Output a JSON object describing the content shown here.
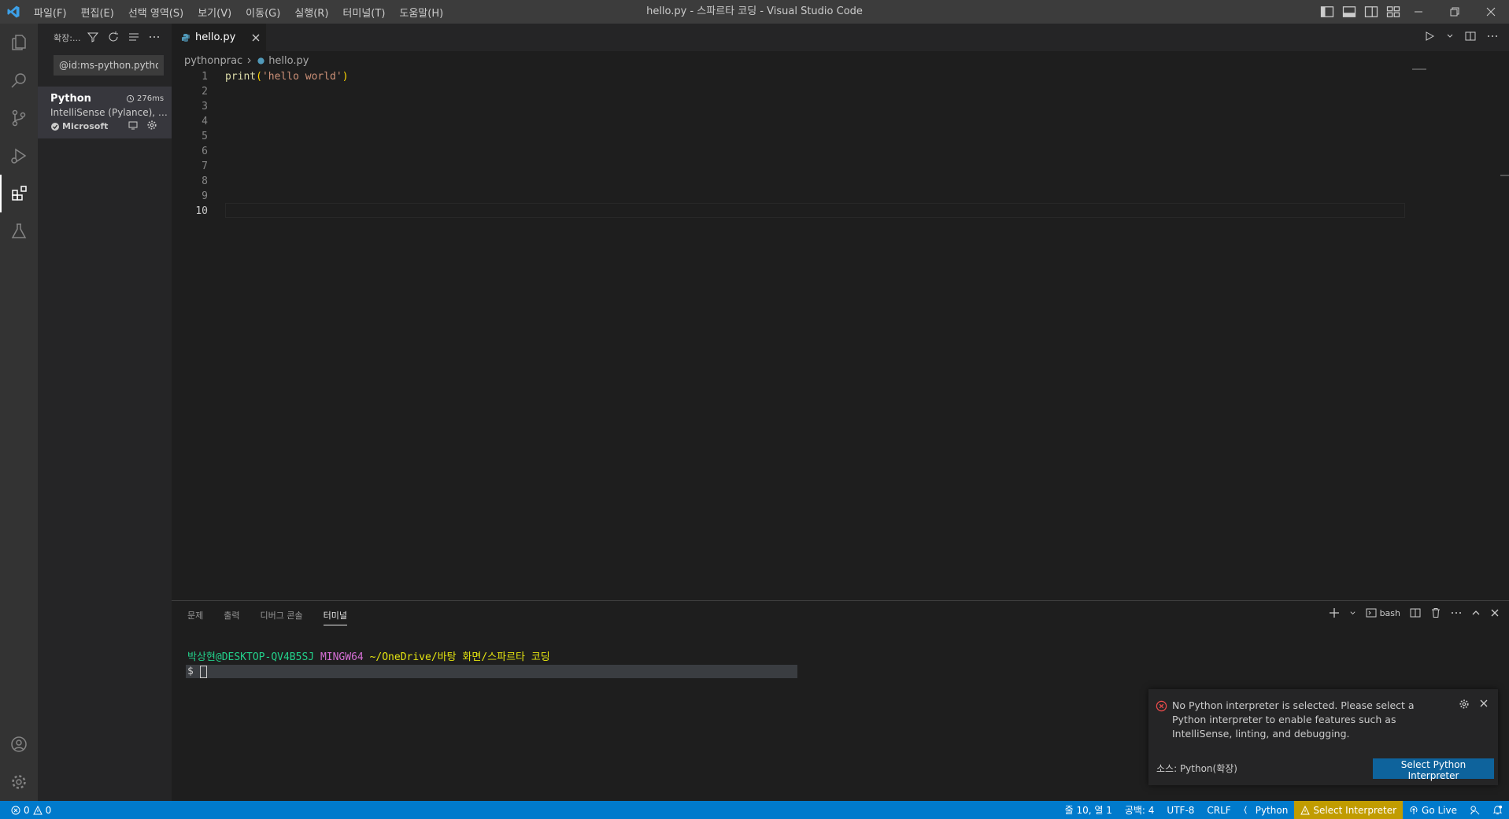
{
  "titlebar": {
    "menus": [
      "파일(F)",
      "편집(E)",
      "선택 영역(S)",
      "보기(V)",
      "이동(G)",
      "실행(R)",
      "터미널(T)",
      "도움말(H)"
    ],
    "title": "hello.py - 스파르타 코딩 - Visual Studio Code"
  },
  "sidebar": {
    "title": "확장:...",
    "search_value": "@id:ms-python.python",
    "extension": {
      "name": "Python",
      "time": "276ms",
      "description": "IntelliSense (Pylance), L...",
      "publisher": "Microsoft"
    }
  },
  "editor": {
    "tab": "hello.py",
    "breadcrumb": [
      "pythonprac",
      "hello.py"
    ],
    "line_numbers": [
      "1",
      "2",
      "3",
      "4",
      "5",
      "6",
      "7",
      "8",
      "9",
      "10"
    ],
    "code": {
      "fn": "print",
      "open": "(",
      "string": "'hello world'",
      "close": ")"
    }
  },
  "panel": {
    "tabs": [
      "문제",
      "출력",
      "디버그 콘솔",
      "터미널"
    ],
    "shell": "bash",
    "terminal": {
      "user": "박상현@DESKTOP-QV4B5SJ",
      "env": "MINGW64",
      "path": "~/OneDrive/바탕 화면/스파르타 코딩",
      "prompt": "$"
    }
  },
  "notification": {
    "message": "No Python interpreter is selected. Please select a Python interpreter to enable features such as IntelliSense, linting, and debugging.",
    "source": "소스: Python(확장)",
    "button": "Select Python Interpreter"
  },
  "statusbar": {
    "errors": "0",
    "warnings": "0",
    "position": "줄 10, 열 1",
    "spaces": "공백: 4",
    "encoding": "UTF-8",
    "eol": "CRLF",
    "language": "Python",
    "interpreter": "Select Interpreter",
    "golive": "Go Live"
  },
  "colors": {
    "accent": "#007acc",
    "button": "#0e639c",
    "warning_bg": "#c19c00",
    "error": "#f14c4c",
    "string": "#ce9178",
    "function": "#dcdcaa"
  }
}
